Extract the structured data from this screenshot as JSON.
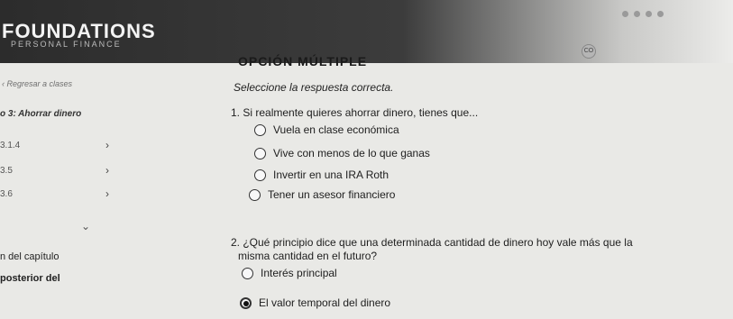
{
  "brand": {
    "title": "FOUNDATIONS",
    "subtitle": "PERSONAL FINANCE"
  },
  "sidebar": {
    "back_link": "Regresar a clases",
    "current_chapter": "o 3: Ahorrar dinero",
    "items": [
      {
        "label": "3.1.4"
      },
      {
        "label": "3.5"
      },
      {
        "label": "3.6"
      }
    ],
    "footer_text_1": "n del capítulo",
    "footer_text_2": "posterior del"
  },
  "quiz": {
    "section_title": "OPCIÓN MÚLTIPLE",
    "instruction": "Seleccione la respuesta correcta.",
    "questions": [
      {
        "text": "1. Si realmente quieres ahorrar dinero, tienes que...",
        "options": [
          {
            "label": "Vuela en clase económica",
            "selected": false
          },
          {
            "label": "Vive con menos de lo que ganas",
            "selected": false
          },
          {
            "label": "Invertir en una IRA Roth",
            "selected": false
          },
          {
            "label": "Tener un asesor financiero",
            "selected": false
          }
        ]
      },
      {
        "text_line1": "2. ¿Qué principio dice que una determinada cantidad de dinero hoy vale más que la",
        "text_line2": "misma cantidad en el futuro?",
        "options": [
          {
            "label": "Interés principal",
            "selected": false
          },
          {
            "label": "El valor temporal del dinero",
            "selected": true
          }
        ]
      }
    ]
  }
}
